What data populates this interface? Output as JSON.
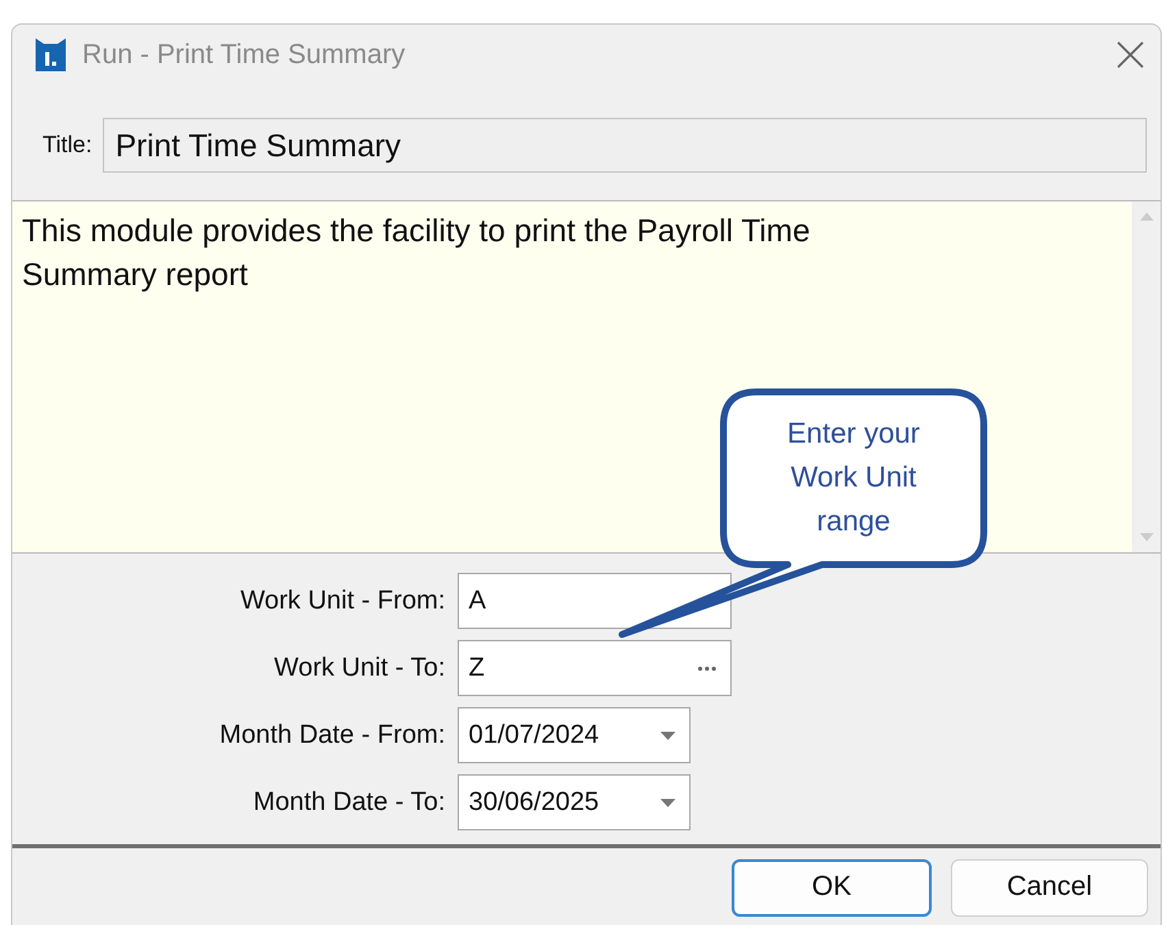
{
  "window": {
    "title": "Run - Print Time Summary"
  },
  "title_field": {
    "label": "Title:",
    "value": "Print Time Summary"
  },
  "description": "This module provides the facility to print the Payroll Time Summary report",
  "callout": {
    "text": "Enter your Work Unit range"
  },
  "fields": [
    {
      "label": "Work Unit - From:",
      "value": "A",
      "kind": "text"
    },
    {
      "label": "Work Unit - To:",
      "value": "Z",
      "kind": "lookup"
    },
    {
      "label": "Month Date - From:",
      "value": "01/07/2024",
      "kind": "date"
    },
    {
      "label": "Month Date - To:",
      "value": "30/06/2025",
      "kind": "date"
    }
  ],
  "buttons": [
    {
      "label": "OK",
      "default": true
    },
    {
      "label": "Cancel",
      "default": false
    }
  ]
}
